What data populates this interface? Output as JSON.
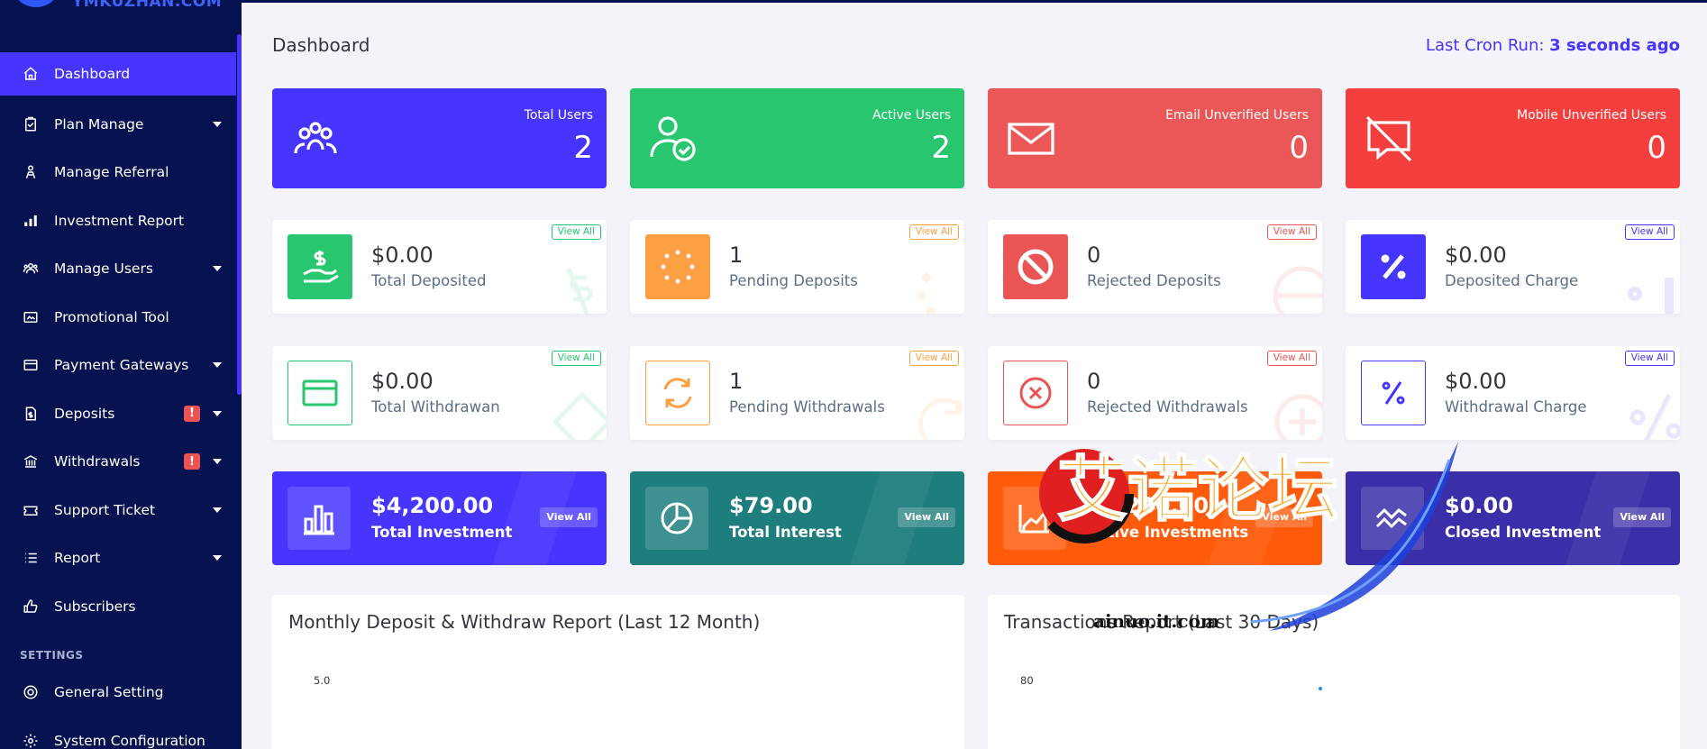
{
  "brand": {
    "name": "YMKUZHAN.COM"
  },
  "sidebar": {
    "items": [
      {
        "label": "Dashboard",
        "icon": "home-icon",
        "active": true
      },
      {
        "label": "Plan Manage",
        "icon": "clipboard-icon",
        "has_submenu": true
      },
      {
        "label": "Manage Referral",
        "icon": "referral-icon"
      },
      {
        "label": "Investment Report",
        "icon": "bar-chart-icon"
      },
      {
        "label": "Manage Users",
        "icon": "users-icon",
        "has_submenu": true
      },
      {
        "label": "Promotional Tool",
        "icon": "image-icon"
      },
      {
        "label": "Payment Gateways",
        "icon": "credit-card-icon",
        "has_submenu": true
      },
      {
        "label": "Deposits",
        "icon": "file-dollar-icon",
        "has_submenu": true,
        "badge": "!"
      },
      {
        "label": "Withdrawals",
        "icon": "bank-icon",
        "has_submenu": true,
        "badge": "!"
      },
      {
        "label": "Support Ticket",
        "icon": "ticket-icon",
        "has_submenu": true
      },
      {
        "label": "Report",
        "icon": "list-icon",
        "has_submenu": true
      },
      {
        "label": "Subscribers",
        "icon": "thumbs-up-icon"
      }
    ],
    "settings_header": "SETTINGS",
    "settings_items": [
      {
        "label": "General Setting",
        "icon": "life-ring-icon"
      },
      {
        "label": "System Configuration",
        "icon": "gear-icon"
      }
    ]
  },
  "header": {
    "title": "Dashboard",
    "cron_label": "Last Cron Run:",
    "cron_value": "3 seconds ago"
  },
  "widgets": [
    {
      "label": "Total Users",
      "value": "2",
      "color": "#4634ff",
      "icon": "users-group-icon"
    },
    {
      "label": "Active Users",
      "value": "2",
      "color": "#28c76f",
      "icon": "user-check-icon"
    },
    {
      "label": "Email Unverified Users",
      "value": "0",
      "color": "#eb5757",
      "icon": "envelope-icon"
    },
    {
      "label": "Mobile Unverified Users",
      "value": "0",
      "color": "#f53e3e",
      "icon": "comment-slash-icon"
    }
  ],
  "deposit_stats": [
    {
      "value": "$0.00",
      "label": "Total Deposited",
      "button": "View All",
      "color": "#28c76f",
      "style": "filled",
      "icon": "hand-dollar-icon"
    },
    {
      "value": "1",
      "label": "Pending Deposits",
      "button": "View All",
      "color": "#ff9f43",
      "style": "filled",
      "icon": "spinner-icon"
    },
    {
      "value": "0",
      "label": "Rejected Deposits",
      "button": "View All",
      "color": "#ea5455",
      "style": "filled",
      "icon": "ban-icon"
    },
    {
      "value": "$0.00",
      "label": "Deposited Charge",
      "button": "View All",
      "color": "#4634ff",
      "style": "filled",
      "icon": "percent-icon"
    }
  ],
  "withdraw_stats": [
    {
      "value": "$0.00",
      "label": "Total Withdrawan",
      "button": "View All",
      "color": "#28c76f",
      "style": "outline",
      "icon": "credit-card-icon"
    },
    {
      "value": "1",
      "label": "Pending Withdrawals",
      "button": "View All",
      "color": "#ff9f43",
      "style": "outline",
      "icon": "sync-icon"
    },
    {
      "value": "0",
      "label": "Rejected Withdrawals",
      "button": "View All",
      "color": "#ea5455",
      "style": "outline",
      "icon": "times-circle-icon"
    },
    {
      "value": "$0.00",
      "label": "Withdrawal Charge",
      "button": "View All",
      "color": "#4634ff",
      "style": "outline",
      "icon": "percent-icon"
    }
  ],
  "investments": [
    {
      "value": "$4,200.00",
      "label": "Total Investment",
      "button": "View All",
      "color": "#4634ff",
      "icon": "bar-chart-icon"
    },
    {
      "value": "$79.00",
      "label": "Total Interest",
      "button": "View All",
      "color": "#1e7d7d",
      "icon": "pie-chart-icon"
    },
    {
      "value": "$4,200.00",
      "label": "Active Investments",
      "button": "View All",
      "color": "#ff5b0a",
      "icon": "area-chart-icon"
    },
    {
      "value": "$0.00",
      "label": "Closed Investment",
      "button": "View All",
      "color": "#3a2fa8",
      "icon": "wave-chart-icon"
    }
  ],
  "charts": [
    {
      "title": "Monthly Deposit & Withdraw Report (Last 12 Month)",
      "y_tick": "5.0"
    },
    {
      "title": "Transactions Report (Last 30 Days)",
      "y_tick": "80"
    }
  ],
  "watermark": {
    "brand": "艾诺论坛",
    "url": "ainuo.it.com"
  }
}
